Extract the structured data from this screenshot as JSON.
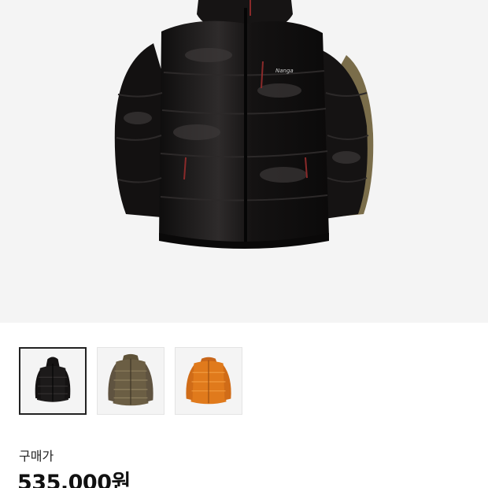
{
  "product": {
    "main_image": "black-down-jacket-photo",
    "thumbnails": [
      {
        "name": "black-down-jacket-thumbnail",
        "color": "#1c1a1a",
        "selected": true
      },
      {
        "name": "olive-down-jacket-thumbnail",
        "color": "#6b5e44",
        "selected": false
      },
      {
        "name": "orange-down-jacket-thumbnail",
        "color": "#e07a1c",
        "selected": false
      }
    ]
  },
  "price": {
    "label": "구매가",
    "value": "535,000원"
  }
}
